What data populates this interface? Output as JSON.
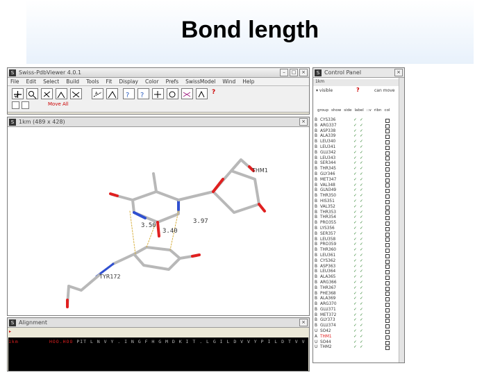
{
  "slide": {
    "title": "Bond length"
  },
  "main_window": {
    "title": "Swiss-PdbViewer 4.0.1",
    "menu": [
      "File",
      "Edit",
      "Select",
      "Build",
      "Tools",
      "Fit",
      "Display",
      "Color",
      "Prefs",
      "SwissModel",
      "Wind",
      "Help"
    ],
    "mode_label": "Move All"
  },
  "viewer_window": {
    "title": "1km (489 x 428)",
    "labels": {
      "thm": "THM1",
      "tyr": "TYR172",
      "d1": "3.50",
      "d2": "3.40",
      "d3": "3.97"
    }
  },
  "alignment_window": {
    "title": "Alignment",
    "row_label": "1km",
    "sequence_hl": "HOO.HOO",
    "sequence": "PIT  L N V Y  .  I N G F H G M D K I T  .  L  G  I  L  D  V  V  Y  P  I  L  D  T  V  V  N  V  Z  I  G  A  S  I  L  I  A  N  Y  E"
  },
  "control_panel": {
    "title": "Control Panel",
    "group": "1km",
    "visible_label": "visible",
    "can_move_label": "can move",
    "columns": [
      "group",
      "show",
      "side",
      "label",
      "::v",
      "ribn",
      "col"
    ],
    "residues": [
      {
        "b": "B",
        "res": "CYS336",
        "hl": false
      },
      {
        "b": "B",
        "res": "ARG337",
        "hl": false
      },
      {
        "b": "B",
        "res": "ASP338",
        "hl": false
      },
      {
        "b": "B",
        "res": "ALA339",
        "hl": false
      },
      {
        "b": "B",
        "res": "LEU340",
        "hl": false
      },
      {
        "b": "B",
        "res": "LEU341",
        "hl": false
      },
      {
        "b": "B",
        "res": "GLU342",
        "hl": false
      },
      {
        "b": "B",
        "res": "LEU343",
        "hl": false
      },
      {
        "b": "B",
        "res": "SER344",
        "hl": false
      },
      {
        "b": "B",
        "res": "THR345",
        "hl": false
      },
      {
        "b": "B",
        "res": "GLY346",
        "hl": false
      },
      {
        "b": "B",
        "res": "MET347",
        "hl": false
      },
      {
        "b": "B",
        "res": "VAL348",
        "hl": false
      },
      {
        "b": "B",
        "res": "GLN349",
        "hl": false
      },
      {
        "b": "B",
        "res": "THR350",
        "hl": false
      },
      {
        "b": "B",
        "res": "HIS351",
        "hl": false
      },
      {
        "b": "B",
        "res": "VAL352",
        "hl": false
      },
      {
        "b": "B",
        "res": "THR353",
        "hl": false
      },
      {
        "b": "B",
        "res": "THR354",
        "hl": false
      },
      {
        "b": "B",
        "res": "PRO355",
        "hl": false
      },
      {
        "b": "B",
        "res": "LYS356",
        "hl": false
      },
      {
        "b": "B",
        "res": "SER357",
        "hl": false
      },
      {
        "b": "B",
        "res": "LEU358",
        "hl": false
      },
      {
        "b": "B",
        "res": "PRO359",
        "hl": false
      },
      {
        "b": "B",
        "res": "THR360",
        "hl": false
      },
      {
        "b": "B",
        "res": "LEU361",
        "hl": false
      },
      {
        "b": "B",
        "res": "CYS362",
        "hl": false
      },
      {
        "b": "B",
        "res": "ASP363",
        "hl": false
      },
      {
        "b": "B",
        "res": "LEU364",
        "hl": false
      },
      {
        "b": "B",
        "res": "ALA365",
        "hl": false
      },
      {
        "b": "B",
        "res": "ARG366",
        "hl": false
      },
      {
        "b": "B",
        "res": "THR367",
        "hl": false
      },
      {
        "b": "B",
        "res": "PHE368",
        "hl": false
      },
      {
        "b": "B",
        "res": "ALA369",
        "hl": false
      },
      {
        "b": "B",
        "res": "ARG370",
        "hl": false
      },
      {
        "b": "B",
        "res": "GLU371",
        "hl": false
      },
      {
        "b": "B",
        "res": "MET372",
        "hl": false
      },
      {
        "b": "B",
        "res": "GLY373",
        "hl": false
      },
      {
        "b": "B",
        "res": "GLU374",
        "hl": false
      },
      {
        "b": "U",
        "res": "SO42",
        "hl": false
      },
      {
        "b": "A",
        "res": "THM1",
        "hl": true
      },
      {
        "b": "U",
        "res": "SO44",
        "hl": false
      },
      {
        "b": "U",
        "res": "THM2",
        "hl": false
      }
    ]
  }
}
